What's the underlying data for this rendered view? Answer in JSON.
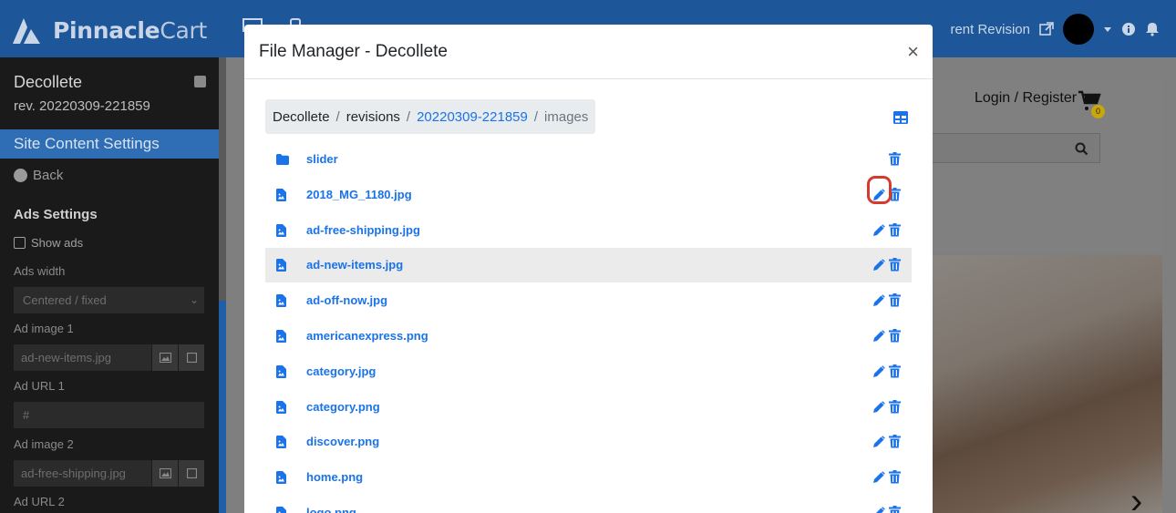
{
  "header": {
    "brand_bold": "Pinnacle",
    "brand_light": "Cart",
    "current_revision": "rent Revision",
    "colors": {
      "bar": "#1e5799",
      "accent": "#1a73e8"
    }
  },
  "sidebar": {
    "site_name": "Decollete",
    "revision": "rev. 20220309-221859",
    "active_section": "Site Content Settings",
    "back_label": "Back",
    "section_heading": "Ads Settings",
    "show_ads_label": "Show ads",
    "ads_width_label": "Ads width",
    "ads_width_value": "Centered / fixed",
    "ad_image_1_label": "Ad image 1",
    "ad_image_1_value": "ad-new-items.jpg",
    "ad_url_1_label": "Ad URL 1",
    "ad_url_1_value": "#",
    "ad_image_2_label": "Ad image 2",
    "ad_image_2_value": "ad-free-shipping.jpg",
    "ad_url_2_label": "Ad URL 2"
  },
  "site": {
    "login_register": "Login / Register",
    "cart_count": "0"
  },
  "modal": {
    "title": "File Manager - Decollete",
    "close": "×",
    "breadcrumb": {
      "root": "Decollete",
      "revisions": "revisions",
      "revision_id": "20220309-221859",
      "current": "images"
    },
    "files": [
      {
        "name": "slider",
        "type": "folder"
      },
      {
        "name": "2018_MG_1180.jpg",
        "type": "image"
      },
      {
        "name": "ad-free-shipping.jpg",
        "type": "image"
      },
      {
        "name": "ad-new-items.jpg",
        "type": "image"
      },
      {
        "name": "ad-off-now.jpg",
        "type": "image"
      },
      {
        "name": "americanexpress.png",
        "type": "image"
      },
      {
        "name": "category.jpg",
        "type": "image"
      },
      {
        "name": "category.png",
        "type": "image"
      },
      {
        "name": "discover.png",
        "type": "image"
      },
      {
        "name": "home.png",
        "type": "image"
      },
      {
        "name": "logo.png",
        "type": "image"
      }
    ]
  }
}
